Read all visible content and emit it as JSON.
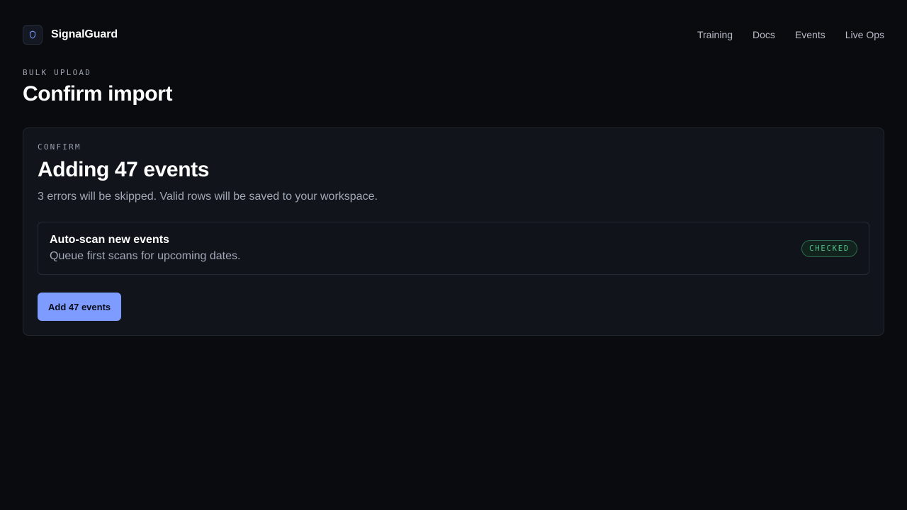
{
  "app": {
    "name": "SignalGuard",
    "logo_icon": "shield-icon",
    "accent_color": "#7e9cff"
  },
  "nav": {
    "items": [
      {
        "label": "Training"
      },
      {
        "label": "Docs"
      },
      {
        "label": "Events"
      },
      {
        "label": "Live Ops"
      }
    ]
  },
  "page": {
    "eyebrow": "BULK UPLOAD",
    "title": "Confirm import"
  },
  "confirm_card": {
    "eyebrow": "CONFIRM",
    "title": "Adding 47 events",
    "description": "3 errors will be skipped. Valid rows will be saved to your workspace.",
    "option": {
      "title": "Auto-scan new events",
      "subtitle": "Queue first scans for upcoming dates.",
      "status": "CHECKED",
      "status_color": "#4fc18b"
    },
    "primary_button_label": "Add 47 events"
  }
}
